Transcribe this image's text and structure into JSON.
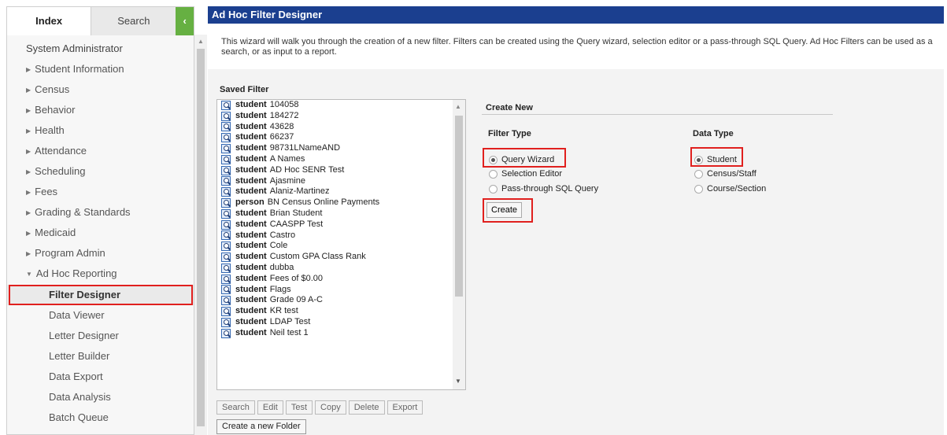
{
  "nav": {
    "tabs": [
      {
        "label": "Index",
        "active": true
      },
      {
        "label": "Search",
        "active": false
      }
    ],
    "collapse_glyph": "‹",
    "root": "System Administrator",
    "items": [
      {
        "label": "Student Information",
        "expanded": false
      },
      {
        "label": "Census",
        "expanded": false
      },
      {
        "label": "Behavior",
        "expanded": false
      },
      {
        "label": "Health",
        "expanded": false
      },
      {
        "label": "Attendance",
        "expanded": false
      },
      {
        "label": "Scheduling",
        "expanded": false
      },
      {
        "label": "Fees",
        "expanded": false
      },
      {
        "label": "Grading & Standards",
        "expanded": false
      },
      {
        "label": "Medicaid",
        "expanded": false
      },
      {
        "label": "Program Admin",
        "expanded": false
      },
      {
        "label": "Ad Hoc Reporting",
        "expanded": true
      }
    ],
    "subitems": [
      {
        "label": "Filter Designer",
        "selected": true
      },
      {
        "label": "Data Viewer",
        "selected": false
      },
      {
        "label": "Letter Designer",
        "selected": false
      },
      {
        "label": "Letter Builder",
        "selected": false
      },
      {
        "label": "Data Export",
        "selected": false
      },
      {
        "label": "Data Analysis",
        "selected": false
      },
      {
        "label": "Batch Queue",
        "selected": false
      }
    ]
  },
  "header": {
    "title": "Ad Hoc Filter Designer"
  },
  "intro": "This wizard will walk you through the creation of a new filter. Filters can be created using the Query wizard, selection editor or a pass-through SQL Query. Ad Hoc Filters can be used as a search, or as input to a report.",
  "saved_filter": {
    "title": "Saved Filter",
    "items": [
      {
        "type": "student",
        "name": "104058",
        "icon": "query-wizard-filter-icon"
      },
      {
        "type": "student",
        "name": "184272",
        "icon": "query-wizard-filter-icon"
      },
      {
        "type": "student",
        "name": "43628",
        "icon": "query-wizard-filter-icon"
      },
      {
        "type": "student",
        "name": "66237",
        "icon": "query-wizard-filter-icon"
      },
      {
        "type": "student",
        "name": "98731LNameAND",
        "icon": "query-wizard-filter-icon"
      },
      {
        "type": "student",
        "name": "A Names",
        "icon": "selection-filter-icon"
      },
      {
        "type": "student",
        "name": "AD Hoc SENR Test",
        "icon": "query-wizard-filter-icon"
      },
      {
        "type": "student",
        "name": "Ajasmine",
        "icon": "selection-filter-icon"
      },
      {
        "type": "student",
        "name": "Alaniz-Martinez",
        "icon": "query-wizard-filter-icon"
      },
      {
        "type": "person",
        "name": "BN Census Online Payments",
        "icon": "query-wizard-filter-icon"
      },
      {
        "type": "student",
        "name": "Brian Student",
        "icon": "query-wizard-filter-icon"
      },
      {
        "type": "student",
        "name": "CAASPP Test",
        "icon": "query-wizard-filter-icon"
      },
      {
        "type": "student",
        "name": "Castro",
        "icon": "selection-filter-icon"
      },
      {
        "type": "student",
        "name": "Cole",
        "icon": "selection-filter-icon"
      },
      {
        "type": "student",
        "name": "Custom GPA Class Rank",
        "icon": "query-wizard-filter-icon"
      },
      {
        "type": "student",
        "name": "dubba",
        "icon": "query-wizard-filter-icon"
      },
      {
        "type": "student",
        "name": "Fees of $0.00",
        "icon": "query-wizard-filter-icon"
      },
      {
        "type": "student",
        "name": "Flags",
        "icon": "query-wizard-filter-icon"
      },
      {
        "type": "student",
        "name": "Grade 09 A-C",
        "icon": "query-wizard-filter-icon"
      },
      {
        "type": "student",
        "name": "KR test",
        "icon": "query-wizard-filter-icon"
      },
      {
        "type": "student",
        "name": "LDAP Test",
        "icon": "query-wizard-filter-icon"
      },
      {
        "type": "student",
        "name": "Neil test 1",
        "icon": "query-wizard-filter-icon"
      }
    ],
    "buttons": [
      "Search",
      "Edit",
      "Test",
      "Copy",
      "Delete",
      "Export"
    ],
    "folder_button": "Create a new Folder"
  },
  "create_new": {
    "title": "Create New",
    "filter_type": {
      "label": "Filter Type",
      "options": [
        {
          "label": "Query Wizard",
          "checked": true
        },
        {
          "label": "Selection Editor",
          "checked": false
        },
        {
          "label": "Pass-through SQL Query",
          "checked": false
        }
      ]
    },
    "data_type": {
      "label": "Data Type",
      "options": [
        {
          "label": "Student",
          "checked": true
        },
        {
          "label": "Census/Staff",
          "checked": false
        },
        {
          "label": "Course/Section",
          "checked": false
        }
      ]
    },
    "create_button": "Create"
  },
  "colors": {
    "header_bg": "#1b3f8f",
    "collapse_bg": "#66b042",
    "highlight": "#e0201e"
  }
}
